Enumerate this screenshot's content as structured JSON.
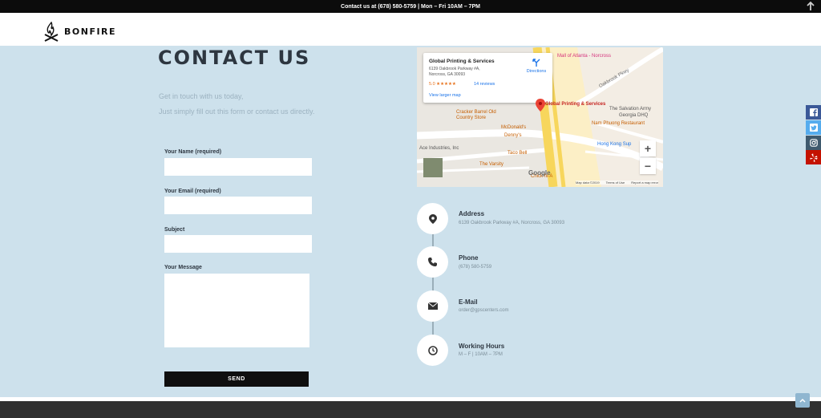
{
  "topbar": {
    "text": "Contact us at (678) 580-5759 | Mon – Fri 10AM – 7PM"
  },
  "brand": {
    "name": "BONFIRE"
  },
  "contact": {
    "title": "CONTACT US",
    "intro_line1": "Get in touch with us today,",
    "intro_line2": "Just simply fill out this form or contact us directly."
  },
  "form": {
    "name_label": "Your Name (required)",
    "email_label": "Your Email (required)",
    "subject_label": "Subject",
    "message_label": "Your Message",
    "name_value": "",
    "email_value": "",
    "subject_value": "",
    "message_value": "",
    "send_label": "SEND"
  },
  "map": {
    "place_name": "Global Printing & Services",
    "place_address": "6139 Oakbrook Parkway #A, Norcross, GA 30093",
    "rating": "5.0 ★★★★★",
    "reviews": "14 reviews",
    "directions": "Directions",
    "larger_map": "View larger map",
    "pin_label": "Global Printing & Services",
    "labels": {
      "mall": "Mall of Atlanta - Norcross",
      "oakbrook": "Oakbrook Pkwy",
      "salvation": "The Salvation Army",
      "georgia": "Georgia DHQ",
      "nam_phuong": "Nam Phuong Restaurant",
      "cracker": "Cracker Barrel Old Country Store",
      "mcdonalds": "McDonald's",
      "dennys": "Denny's",
      "hong_kong": "Hong Kong Sup",
      "ace": "Ace Industries, Inc",
      "taco": "Taco Bell",
      "varsity": "The Varsity",
      "chick": "Chick-fil-A"
    },
    "google": "Google",
    "attrib_data": "Map data ©2019",
    "attrib_terms": "Terms of Use",
    "attrib_report": "Report a map error",
    "zoom_in": "+",
    "zoom_out": "−"
  },
  "info": {
    "address_title": "Address",
    "address_value": "6139 Oakbrook Parkway #A, Norcross, GA 30093",
    "phone_title": "Phone",
    "phone_value": "(678) 580-5759",
    "email_title": "E-Mail",
    "email_value": "order@gpscenters.com",
    "hours_title": "Working Hours",
    "hours_value": "M – F | 10AM – 7PM"
  },
  "social": [
    "facebook-icon",
    "twitter-icon",
    "instagram-icon",
    "yelp-icon"
  ],
  "colors": {
    "page_bg": "#cde1ec",
    "facebook": "#3b5998",
    "twitter": "#55acee",
    "instagram": "#3f5a6e",
    "yelp": "#c41200"
  }
}
